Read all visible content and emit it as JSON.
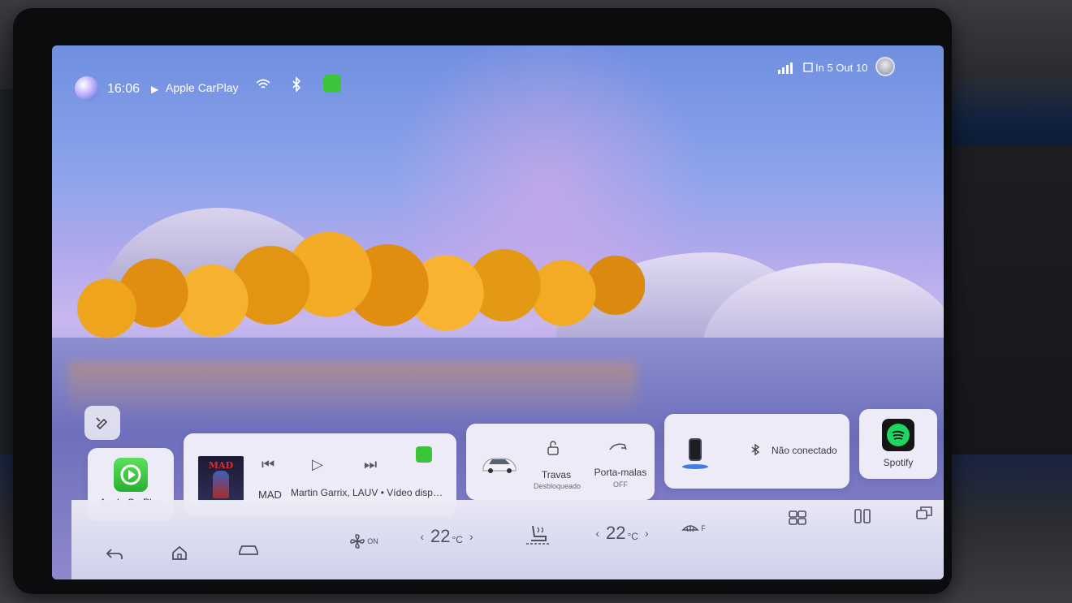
{
  "status_bar": {
    "time": "16:06",
    "source_label": "Apple CarPlay",
    "date": "In 5 Out 10",
    "icons": [
      "assistant-orb-icon",
      "play-icon",
      "wifi-icon",
      "bluetooth-icon",
      "carplay-icon",
      "signal-icon",
      "weather-icon",
      "avatar"
    ]
  },
  "widgets": {
    "carplay": {
      "label": "Apple CarPlay"
    },
    "music": {
      "album_title": "MAD",
      "song": "MAD",
      "artist_line": "Martin Garrix, LAUV • Vídeo dispo...",
      "controls": {
        "prev": "⏮",
        "play": "▷",
        "next": "⏭"
      }
    },
    "vehicle": {
      "locks_label": "Travas",
      "locks_state": "Desbloqueado",
      "trunk_label": "Porta-malas",
      "trunk_state": "OFF"
    },
    "phone": {
      "status": "Não conectado"
    },
    "spotify": {
      "label": "Spotify"
    }
  },
  "dock": {
    "fan_state": "ON",
    "temp_left": "22",
    "temp_right": "22",
    "temp_unit": "°C",
    "defrost_label": "F",
    "chevron_left": "‹",
    "chevron_right": "›"
  },
  "colors": {
    "accent_green": "#3cc43c",
    "spotify_green": "#1ed760",
    "card_bg": "#f6f5fc"
  }
}
